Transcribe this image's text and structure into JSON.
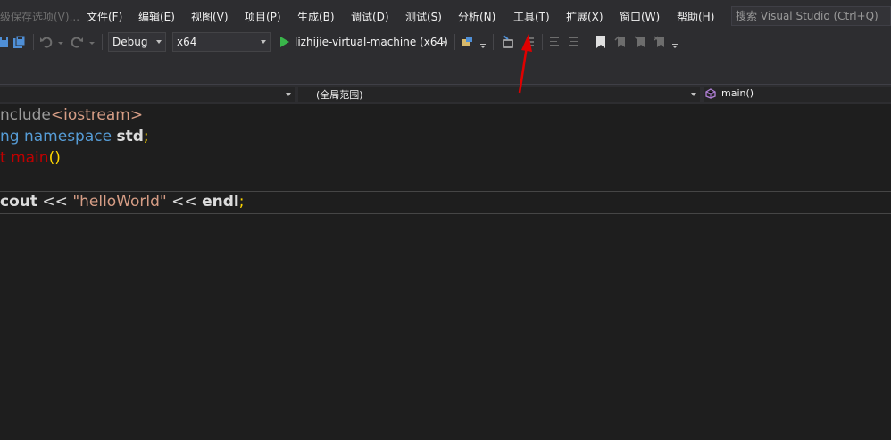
{
  "menu": {
    "partial_item": "级保存选项(V)...",
    "items": [
      "文件(F)",
      "编辑(E)",
      "视图(V)",
      "项目(P)",
      "生成(B)",
      "调试(D)",
      "测试(S)",
      "分析(N)",
      "工具(T)",
      "扩展(X)",
      "窗口(W)",
      "帮助(H)"
    ],
    "search_placeholder": "搜索 Visual Studio (Ctrl+Q)"
  },
  "toolbar": {
    "configuration": "Debug",
    "platform": "x64",
    "run_target": "lizhijie-virtual-machine (x64)"
  },
  "navbar": {
    "scope": "(全局范围)",
    "member": "main()"
  },
  "code": {
    "line1_directive": "nclude",
    "line1_header": "<iostream>",
    "line2_keyword1": "ng",
    "line2_keyword2": "namespace",
    "line2_ident": "std",
    "line2_semicolon": ";",
    "line3_type": "t",
    "line3_func": "main",
    "line3_parens": "()",
    "line5_cout": "cout",
    "line5_op1": "<<",
    "line5_string": "\"helloWorld\"",
    "line5_op2": "<<",
    "line5_endl": "endl",
    "line5_semicolon": ";"
  },
  "colors": {
    "menubar_bg": "#2d2d30",
    "editor_bg": "#1e1e1e",
    "keyword": "#569cd6",
    "string": "#d69d85",
    "function": "#c00000",
    "annotation_arrow": "#e00000"
  },
  "icons": [
    "save-all-icon",
    "undo-icon",
    "redo-icon",
    "start-debug-icon",
    "browse-icon",
    "bookmark-icon",
    "member-icon"
  ]
}
